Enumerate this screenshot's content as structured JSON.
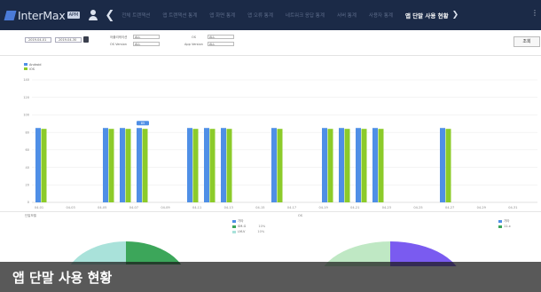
{
  "app": {
    "name": "InterMax",
    "edition_badge": "APM"
  },
  "nav": {
    "tabs": [
      "전체 트랜잭션",
      "앱 트랜잭션 통계",
      "앱 화면 통계",
      "앱 오류 통계",
      "네트워크 응답 통계",
      "서버 통계",
      "사용자 통계",
      "앱 단말 사용 현황"
    ],
    "active_index": 7,
    "next_label": "❯"
  },
  "filters": {
    "date_start": "2019-04-01",
    "date_end": "2019-04-30",
    "label_app": "어플리케이션",
    "value_app": "ALL",
    "label_os_version": "OS Version",
    "value_os_version": "ALL",
    "label_os": "OS",
    "value_os": "ALL",
    "label_app_version": "App Version",
    "value_app_version": "ALL",
    "search_button": "조회"
  },
  "legend": {
    "android": "Android",
    "ios": "iOS"
  },
  "colors": {
    "android": "#4f8fe6",
    "ios": "#8ccb2a",
    "pie_left_a": "#a9e2da",
    "pie_left_b": "#3ca65a",
    "pie_right_a": "#bfe8c4",
    "pie_right_b": "#7a5bf0"
  },
  "chart_data": {
    "type": "bar",
    "categories": [
      "04-01",
      "04-02",
      "04-03",
      "04-04",
      "04-05",
      "04-06",
      "04-07",
      "04-08",
      "04-09",
      "04-10",
      "04-11",
      "04-12",
      "04-13",
      "04-14",
      "04-15",
      "04-16",
      "04-17",
      "04-18",
      "04-19",
      "04-20",
      "04-21",
      "04-22",
      "04-23",
      "04-24",
      "04-25",
      "04-26",
      "04-27",
      "04-28",
      "04-29",
      "04-30"
    ],
    "x_tick_labels": [
      "04-01",
      "04-03",
      "04-05",
      "04-07",
      "04-09",
      "04-11",
      "04-13",
      "04-15",
      "04-17",
      "04-19",
      "04-21",
      "04-23",
      "04-25",
      "04-27",
      "04-29",
      "04-31"
    ],
    "y_tick_labels": [
      "0",
      "20",
      "40",
      "60",
      "80",
      "100",
      "120",
      "140"
    ],
    "ylim": [
      0,
      140
    ],
    "series": [
      {
        "name": "Android",
        "values": [
          85,
          0,
          0,
          0,
          85,
          85,
          85,
          0,
          0,
          85,
          85,
          85,
          0,
          0,
          85,
          0,
          0,
          85,
          85,
          85,
          85,
          0,
          0,
          0,
          85,
          0,
          0,
          0,
          0,
          0
        ]
      },
      {
        "name": "iOS",
        "values": [
          84,
          0,
          0,
          0,
          84,
          84,
          84,
          0,
          0,
          84,
          84,
          84,
          0,
          0,
          84,
          0,
          0,
          84,
          84,
          84,
          84,
          0,
          0,
          0,
          84,
          0,
          0,
          0,
          0,
          0
        ]
      }
    ],
    "tooltip": {
      "index": 6,
      "text": "85"
    }
  },
  "lower": {
    "left_title": "단말모델",
    "center_title": "OS",
    "left_legend": [
      {
        "label": "기타",
        "value": ""
      },
      {
        "label": "SM-G",
        "value": "10%"
      },
      {
        "label": "LM-V",
        "value": "10%"
      }
    ],
    "right_legend": [
      {
        "label": "기타",
        "value": ""
      },
      {
        "label": "11.x",
        "value": ""
      }
    ]
  },
  "caption": "앱 단말 사용 현황"
}
